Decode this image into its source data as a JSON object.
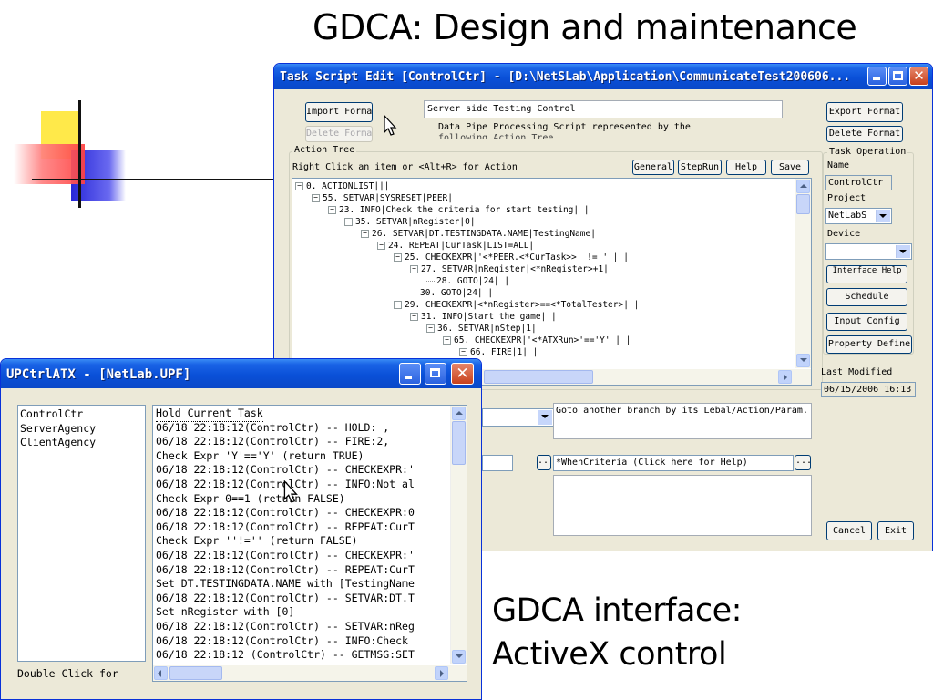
{
  "slide": {
    "title": "GDCA: Design and maintenance",
    "caption_line1": "GDCA interface:",
    "caption_line2": "ActiveX control"
  },
  "task_window": {
    "title": "Task Script Edit [ControlCtr] - [D:\\NetSLab\\Application\\CommunicateTest200606...",
    "import_format": "Import Format",
    "delete_format_left": "Delete Format",
    "description_value": "Server side Testing Control",
    "description_line2": "Data Pipe Processing Script represented by the",
    "description_line3": "following Action Tree",
    "export_format": "Export Format",
    "delete_format_right": "Delete Format",
    "action_tree_label": "Action Tree",
    "action_tree_hint": "Right Click an item  or <Alt+R> for Action",
    "btn_general": "General",
    "btn_steprun": "StepRun",
    "btn_help": "Help",
    "btn_save": "Save",
    "tree": [
      {
        "text": "0. ACTIONLIST|||",
        "level": 0,
        "node": "minus"
      },
      {
        "text": "55. SETVAR|SYSRESET|PEER|",
        "level": 1,
        "node": "minus"
      },
      {
        "text": "23. INFO|Check the criteria for start testing| |",
        "level": 2,
        "node": "minus"
      },
      {
        "text": "35. SETVAR|nRegister|0|",
        "level": 3,
        "node": "minus"
      },
      {
        "text": "26. SETVAR|DT.TESTINGDATA.NAME|TestingName|",
        "level": 4,
        "node": "minus"
      },
      {
        "text": "24. REPEAT|CurTask|LIST=ALL|",
        "level": 5,
        "node": "minus"
      },
      {
        "text": "25. CHECKEXPR|'<*PEER.<*CurTask>>' !='' | |",
        "level": 6,
        "node": "minus"
      },
      {
        "text": "27. SETVAR|nRegister|<*nRegister>+1|",
        "level": 7,
        "node": "minus"
      },
      {
        "text": "28. GOTO|24| |",
        "level": 8,
        "node": "leaf"
      },
      {
        "text": "30. GOTO|24| |",
        "level": 7,
        "node": "leaf"
      },
      {
        "text": "29. CHECKEXPR|<*nRegister>==<*TotalTester>| |",
        "level": 6,
        "node": "minus"
      },
      {
        "text": "31. INFO|Start the game| |",
        "level": 7,
        "node": "minus"
      },
      {
        "text": "36. SETVAR|nStep|1|",
        "level": 8,
        "node": "minus"
      },
      {
        "text": "65. CHECKEXPR|'<*ATXRun>'=='Y' | |",
        "level": 9,
        "node": "minus"
      },
      {
        "text": "66. FIRE|1| |",
        "level": 10,
        "node": "minus"
      }
    ],
    "goto_description": "Goto another branch by its Lebal/Action/Param.",
    "when_criteria": "*WhenCriteria (Click here for Help)",
    "dots_button": "...",
    "task_operation_label": "Task Operation",
    "name_label": "Name",
    "name_value": "ControlCtr",
    "project_label": "Project",
    "project_value": "NetLabS",
    "device_label": "Device",
    "device_value": "",
    "btn_interface_help": "Interface Help",
    "btn_schedule": "Schedule",
    "btn_input_config": "Input Config",
    "btn_property_define": "Property Define",
    "last_modified_label": "Last Modified",
    "last_modified_value": "06/15/2006 16:13",
    "btn_cancel": "Cancel",
    "btn_exit": "Exit"
  },
  "upc_window": {
    "title": "UPCtrlATX - [NetLab.UPF]",
    "list_items": [
      "ControlCtr",
      "ServerAgency",
      "ClientAgency"
    ],
    "hint": "Double Click for",
    "log_lines": [
      "Hold Current Task",
      "06/18 22:18:12(ControlCtr) -- HOLD: ,",
      "06/18 22:18:12(ControlCtr) -- FIRE:2,",
      "Check Expr 'Y'=='Y'  (return TRUE)",
      "06/18 22:18:12(ControlCtr) -- CHECKEXPR:'",
      "06/18 22:18:12(ControlCtr) -- INFO:Not al",
      "Check Expr 0==1  (return FALSE)",
      "06/18 22:18:12(ControlCtr) -- CHECKEXPR:0",
      "06/18 22:18:12(ControlCtr) -- REPEAT:CurT",
      "Check Expr ''!=''  (return FALSE)",
      "06/18 22:18:12(ControlCtr) -- CHECKEXPR:'",
      "06/18 22:18:12(ControlCtr) -- REPEAT:CurT",
      "Set DT.TESTINGDATA.NAME with [TestingName",
      "06/18 22:18:12(ControlCtr) -- SETVAR:DT.T",
      "Set nRegister with [0]",
      "06/18 22:18:12(ControlCtr) -- SETVAR:nReg",
      "06/18 22:18:12(ControlCtr) -- INFO:Check",
      "06/18 22:18:12  (ControlCtr) -- GETMSG:SET"
    ]
  },
  "colors": {
    "xp_title_blue": "#0a50d8",
    "xp_face": "#ece9d8",
    "deco_yellow": "#ffe94a",
    "deco_red": "#ff6a6a",
    "deco_blue": "#3c3ce0"
  }
}
